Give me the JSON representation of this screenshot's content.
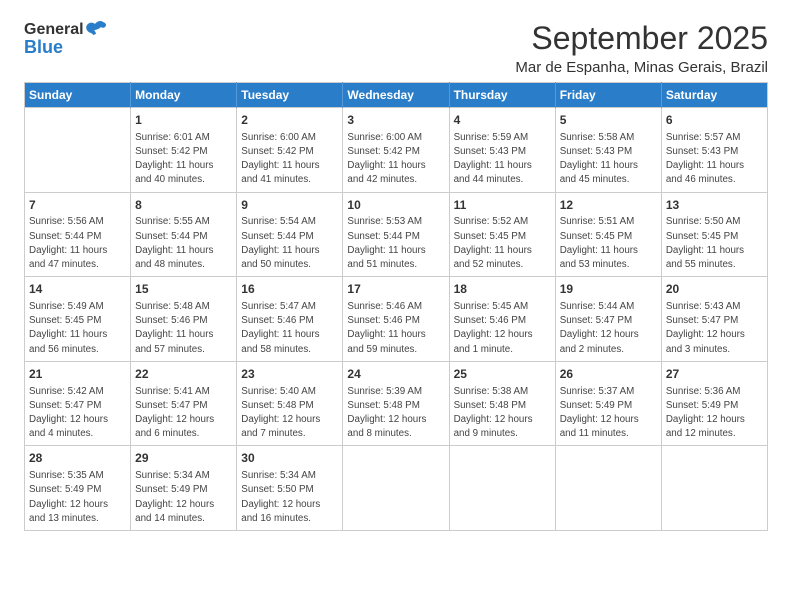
{
  "logo": {
    "general": "General",
    "blue": "Blue"
  },
  "header": {
    "month": "September 2025",
    "location": "Mar de Espanha, Minas Gerais, Brazil"
  },
  "days_of_week": [
    "Sunday",
    "Monday",
    "Tuesday",
    "Wednesday",
    "Thursday",
    "Friday",
    "Saturday"
  ],
  "weeks": [
    [
      {
        "day": null,
        "info": null
      },
      {
        "day": "1",
        "info": "Sunrise: 6:01 AM\nSunset: 5:42 PM\nDaylight: 11 hours\nand 40 minutes."
      },
      {
        "day": "2",
        "info": "Sunrise: 6:00 AM\nSunset: 5:42 PM\nDaylight: 11 hours\nand 41 minutes."
      },
      {
        "day": "3",
        "info": "Sunrise: 6:00 AM\nSunset: 5:42 PM\nDaylight: 11 hours\nand 42 minutes."
      },
      {
        "day": "4",
        "info": "Sunrise: 5:59 AM\nSunset: 5:43 PM\nDaylight: 11 hours\nand 44 minutes."
      },
      {
        "day": "5",
        "info": "Sunrise: 5:58 AM\nSunset: 5:43 PM\nDaylight: 11 hours\nand 45 minutes."
      },
      {
        "day": "6",
        "info": "Sunrise: 5:57 AM\nSunset: 5:43 PM\nDaylight: 11 hours\nand 46 minutes."
      }
    ],
    [
      {
        "day": "7",
        "info": "Sunrise: 5:56 AM\nSunset: 5:44 PM\nDaylight: 11 hours\nand 47 minutes."
      },
      {
        "day": "8",
        "info": "Sunrise: 5:55 AM\nSunset: 5:44 PM\nDaylight: 11 hours\nand 48 minutes."
      },
      {
        "day": "9",
        "info": "Sunrise: 5:54 AM\nSunset: 5:44 PM\nDaylight: 11 hours\nand 50 minutes."
      },
      {
        "day": "10",
        "info": "Sunrise: 5:53 AM\nSunset: 5:44 PM\nDaylight: 11 hours\nand 51 minutes."
      },
      {
        "day": "11",
        "info": "Sunrise: 5:52 AM\nSunset: 5:45 PM\nDaylight: 11 hours\nand 52 minutes."
      },
      {
        "day": "12",
        "info": "Sunrise: 5:51 AM\nSunset: 5:45 PM\nDaylight: 11 hours\nand 53 minutes."
      },
      {
        "day": "13",
        "info": "Sunrise: 5:50 AM\nSunset: 5:45 PM\nDaylight: 11 hours\nand 55 minutes."
      }
    ],
    [
      {
        "day": "14",
        "info": "Sunrise: 5:49 AM\nSunset: 5:45 PM\nDaylight: 11 hours\nand 56 minutes."
      },
      {
        "day": "15",
        "info": "Sunrise: 5:48 AM\nSunset: 5:46 PM\nDaylight: 11 hours\nand 57 minutes."
      },
      {
        "day": "16",
        "info": "Sunrise: 5:47 AM\nSunset: 5:46 PM\nDaylight: 11 hours\nand 58 minutes."
      },
      {
        "day": "17",
        "info": "Sunrise: 5:46 AM\nSunset: 5:46 PM\nDaylight: 11 hours\nand 59 minutes."
      },
      {
        "day": "18",
        "info": "Sunrise: 5:45 AM\nSunset: 5:46 PM\nDaylight: 12 hours\nand 1 minute."
      },
      {
        "day": "19",
        "info": "Sunrise: 5:44 AM\nSunset: 5:47 PM\nDaylight: 12 hours\nand 2 minutes."
      },
      {
        "day": "20",
        "info": "Sunrise: 5:43 AM\nSunset: 5:47 PM\nDaylight: 12 hours\nand 3 minutes."
      }
    ],
    [
      {
        "day": "21",
        "info": "Sunrise: 5:42 AM\nSunset: 5:47 PM\nDaylight: 12 hours\nand 4 minutes."
      },
      {
        "day": "22",
        "info": "Sunrise: 5:41 AM\nSunset: 5:47 PM\nDaylight: 12 hours\nand 6 minutes."
      },
      {
        "day": "23",
        "info": "Sunrise: 5:40 AM\nSunset: 5:48 PM\nDaylight: 12 hours\nand 7 minutes."
      },
      {
        "day": "24",
        "info": "Sunrise: 5:39 AM\nSunset: 5:48 PM\nDaylight: 12 hours\nand 8 minutes."
      },
      {
        "day": "25",
        "info": "Sunrise: 5:38 AM\nSunset: 5:48 PM\nDaylight: 12 hours\nand 9 minutes."
      },
      {
        "day": "26",
        "info": "Sunrise: 5:37 AM\nSunset: 5:49 PM\nDaylight: 12 hours\nand 11 minutes."
      },
      {
        "day": "27",
        "info": "Sunrise: 5:36 AM\nSunset: 5:49 PM\nDaylight: 12 hours\nand 12 minutes."
      }
    ],
    [
      {
        "day": "28",
        "info": "Sunrise: 5:35 AM\nSunset: 5:49 PM\nDaylight: 12 hours\nand 13 minutes."
      },
      {
        "day": "29",
        "info": "Sunrise: 5:34 AM\nSunset: 5:49 PM\nDaylight: 12 hours\nand 14 minutes."
      },
      {
        "day": "30",
        "info": "Sunrise: 5:34 AM\nSunset: 5:50 PM\nDaylight: 12 hours\nand 16 minutes."
      },
      {
        "day": null,
        "info": null
      },
      {
        "day": null,
        "info": null
      },
      {
        "day": null,
        "info": null
      },
      {
        "day": null,
        "info": null
      }
    ]
  ]
}
